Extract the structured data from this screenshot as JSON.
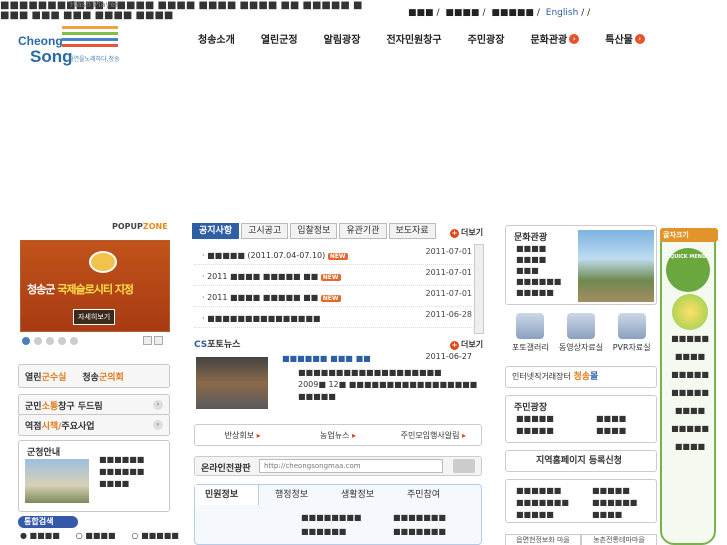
{
  "top": {
    "notice_line1": "■■■■■■■■■■■ ■■■■■ ■■■■ ■■■■ ■■■■ ■■ ■■■■■ ■",
    "notice_line2": "■■■ ■■■ ■■■ ■■■■ ■■■■",
    "flash": "Flash Player"
  },
  "util": {
    "item1": "■■■",
    "item2": "■■■■",
    "item3": "■■■■■",
    "english": "English"
  },
  "logo": {
    "line1": "Cheong",
    "line2": "Song",
    "tagline": "자연을노래하다,청송"
  },
  "gnb": [
    "청송소개",
    "열린군정",
    "알림광장",
    "전자민원창구",
    "주민광장",
    "문화관광",
    "특산물"
  ],
  "popup": {
    "label_a": "POPUP",
    "label_b": "ZONE",
    "banner_pre": "청송군",
    "banner_main": "국제슬로시티 지정",
    "banner_btn": "자세히보기"
  },
  "left_buttons": {
    "b1_a": "열린",
    "b1_b": "군수실",
    "b1_c": "청송",
    "b1_d": "군의회",
    "b2_a": "군민",
    "b2_b": "소통",
    "b2_c": "창구 두드림",
    "b3_a": "역점",
    "b3_b": "시책/",
    "b3_c": "주요사업"
  },
  "gov": {
    "title": "군청안내",
    "items": [
      "■■■■■■",
      "■■■■■■",
      "■■■■"
    ]
  },
  "search": {
    "label": "통합검색",
    "r1": "■■■■",
    "r2": "■■■■",
    "r3": "■■■■■"
  },
  "tabs": [
    "공지사항",
    "고시공고",
    "입찰정보",
    "유관기관",
    "보도자료"
  ],
  "more": "더보기",
  "notice": [
    {
      "text": "■■■■■ (2011.07.04-07.10)",
      "date": "2011-07-01",
      "new": "NEW"
    },
    {
      "text": "2011 ■■■■ ■■■■■ ■■",
      "date": "2011-07-01",
      "new": "NEW"
    },
    {
      "text": "2011 ■■■■ ■■■■■ ■■",
      "date": "2011-07-01",
      "new": "NEW"
    },
    {
      "text": "■■■■■■■■■■■■■■■",
      "date": "2011-06-28",
      "new": ""
    }
  ],
  "photonews": {
    "a": "CS",
    "b": "포토뉴스",
    "title": "■■■■■■ ■■■ ■■",
    "date": "2011-06-27",
    "body1": "■■■■■■■■■■■■■■■■■■■",
    "body2": "2009■ 12■ ■■■■■■■■■■■■■■■■■",
    "body3": "■■■■■"
  },
  "quick3": [
    "반상회보",
    "농업뉴스",
    "주민모임행사알림"
  ],
  "online": {
    "label": "온라인전광판",
    "url": "http://cheongsongmaa.com"
  },
  "civil": {
    "tabs": [
      "민원정보",
      "행정정보",
      "생활정보",
      "주민참여"
    ],
    "items": [
      "■■■■■■■■",
      "■■■■■■■",
      "■■■■■■",
      "■■■■■■■"
    ]
  },
  "culture": {
    "title": "문화관광",
    "items": [
      "■■■■",
      "■■■■",
      "■■■",
      "■■■■■■",
      "■■■■■"
    ]
  },
  "media": [
    "포토갤러리",
    "동영상자료실",
    "PVR자료실"
  ],
  "market": {
    "a": "인터넷직거래장터",
    "b": "청송",
    "c": "몰"
  },
  "jumin": {
    "title": "주민광장",
    "items": [
      "■■■■■",
      "■■■■",
      "■■■■■",
      "■■■■",
      "■■■"
    ]
  },
  "region": {
    "label": "지역홈페이지 등록신청"
  },
  "links": [
    "■■■■■■",
    "■■■■■",
    "■■■■■■■",
    "■■■■■■",
    "■■■■■",
    "■■■■"
  ],
  "bottom_tabs": [
    "읍면현정보화 마을",
    "농촌전통테마마을"
  ],
  "quickmenu": {
    "fontsize": "글자크기",
    "title": "QUICK MENU",
    "items": [
      "■■■■■",
      "■■■■",
      "■■■■■",
      "■■■■■",
      "■■■■",
      "■■■■■",
      "■■■■"
    ]
  },
  "colors": {
    "primary": "#2e5fa5",
    "accent": "#e2471c",
    "orange": "#e07a1a",
    "green": "#79b24d"
  }
}
